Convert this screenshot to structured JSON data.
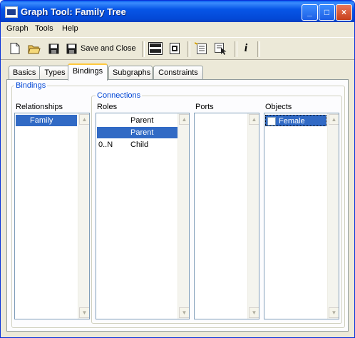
{
  "window": {
    "title": "Graph Tool: Family Tree",
    "controls": [
      "_",
      "□",
      "×"
    ]
  },
  "menu": [
    "Graph",
    "Tools",
    "Help"
  ],
  "toolbar": {
    "save_close_label": "Save and Close",
    "info_label": "i"
  },
  "tabs": [
    "Basics",
    "Types",
    "Bindings",
    "Subgraphs",
    "Constraints"
  ],
  "active_tab": "Bindings",
  "bindings": {
    "group_label": "Bindings",
    "relationships_label": "Relationships",
    "relationships": [
      "Family"
    ],
    "connections_label": "Connections",
    "roles_label": "Roles",
    "roles": [
      {
        "card": "",
        "name": "Parent"
      },
      {
        "card": "",
        "name": "Parent"
      },
      {
        "card": "0..N",
        "name": "Child"
      }
    ],
    "ports_label": "Ports",
    "objects_label": "Objects",
    "objects": [
      "Female"
    ]
  }
}
